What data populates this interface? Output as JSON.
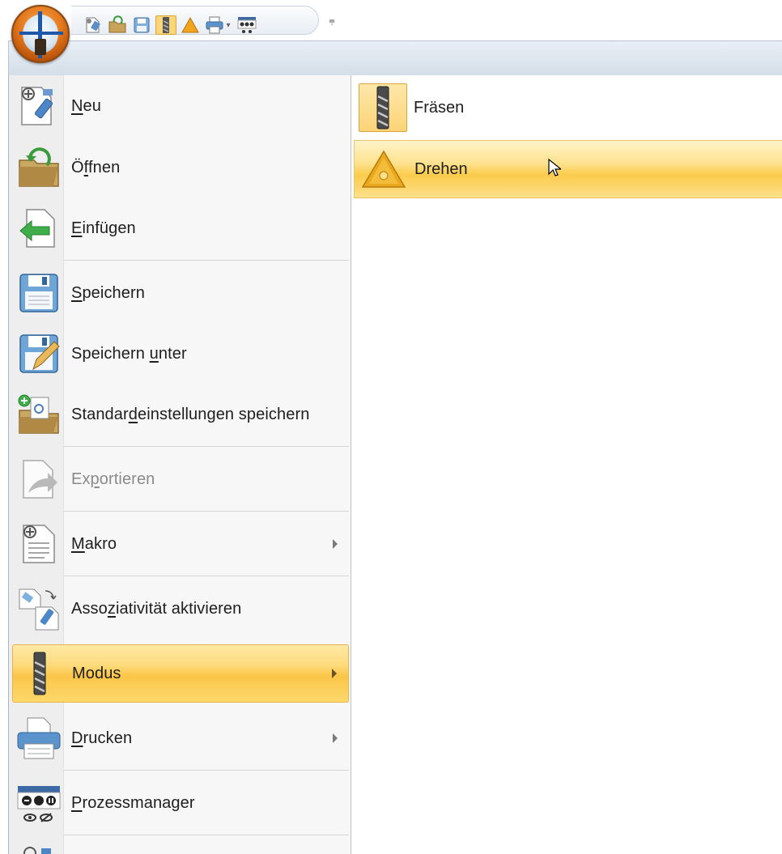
{
  "quick_access": {
    "app_button_icon": "application-logo-icon",
    "buttons": [
      "new-file-icon",
      "open-folder-icon",
      "save-icon",
      "milling-mode-icon",
      "turning-mode-icon",
      "print-icon",
      "process-manager-icon"
    ],
    "customize_glyph": "⩦"
  },
  "menu": {
    "items": [
      {
        "key": "neu",
        "pre": "",
        "acc": "N",
        "post": "eu"
      },
      {
        "key": "oeffnen",
        "pre": "Ö",
        "acc": "f",
        "post": "fnen"
      },
      {
        "key": "einfuegen",
        "pre": "",
        "acc": "E",
        "post": "infügen"
      },
      {
        "key": "speichern",
        "pre": "",
        "acc": "S",
        "post": "peichern"
      },
      {
        "key": "speichern_unter",
        "pre": "Speichern ",
        "acc": "u",
        "post": "nter"
      },
      {
        "key": "standard",
        "pre": "Standar",
        "acc": "d",
        "post": "einstellungen speichern"
      },
      {
        "key": "exportieren",
        "pre": "Ex",
        "acc": "p",
        "post": "ortieren"
      },
      {
        "key": "makro",
        "pre": "",
        "acc": "M",
        "post": "akro"
      },
      {
        "key": "assoziativitaet",
        "pre": "Asso",
        "acc": "z",
        "post": "iativität aktivieren"
      },
      {
        "key": "modus",
        "pre": "Modus",
        "acc": "",
        "post": ""
      },
      {
        "key": "drucken",
        "pre": "",
        "acc": "D",
        "post": "rucken"
      },
      {
        "key": "prozessmanager",
        "pre": "",
        "acc": "P",
        "post": "rozessmanager"
      }
    ]
  },
  "submenu": {
    "items": [
      {
        "label": "Fräsen"
      },
      {
        "label": "Drehen"
      }
    ]
  },
  "colors": {
    "highlight": "#fbc648",
    "ribbon": "#d4dde8",
    "app_button": "#e57a1e"
  }
}
